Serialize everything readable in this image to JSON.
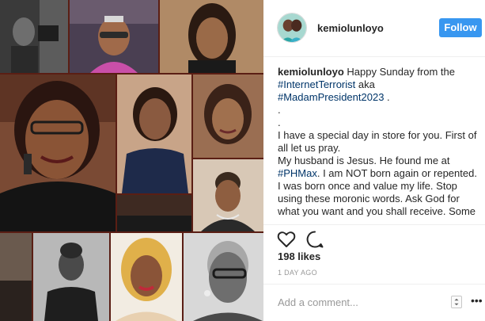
{
  "post": {
    "username": "kemiolunloyo",
    "follow_label": "Follow"
  },
  "caption": {
    "username": "kemiolunloyo",
    "text_intro": " Happy Sunday from the ",
    "tag1": "#InternetTerrorist",
    "text_aka": " aka ",
    "tag2": "#MadamPresident2023",
    "text_after_tag2": " .",
    "dot1": ".",
    "dot2": ".",
    "line1": "I have a special day in store for you. First of all let us pray.",
    "line2_before": "My husband is Jesus. He found me at ",
    "tag3": "#PHMax",
    "line2_after": ". I am NOT born again or repented. I was born once and value my life. Stop using these moronic words. Ask God for what you want and you shall receive. Some"
  },
  "actions": {
    "likes": "198 likes",
    "time": "1 DAY AGO"
  },
  "comment": {
    "placeholder": "Add a comment...",
    "more": "•••"
  },
  "colors": {
    "follow": "#3897f0",
    "hashtag": "#003569",
    "collage_bg": "#5a1e14"
  }
}
